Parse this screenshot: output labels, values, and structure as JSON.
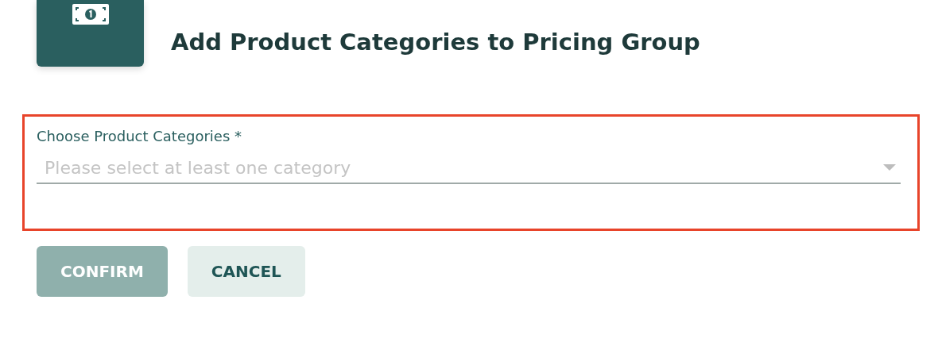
{
  "header": {
    "title": "Add Product Categories to Pricing Group"
  },
  "field": {
    "label": "Choose Product Categories *",
    "placeholder": "Please select at least one category",
    "highlighted": true
  },
  "buttons": [
    {
      "label": "CONFIRM",
      "kind": "primary",
      "disabled": true
    },
    {
      "label": "CANCEL",
      "kind": "secondary",
      "disabled": false
    }
  ]
}
